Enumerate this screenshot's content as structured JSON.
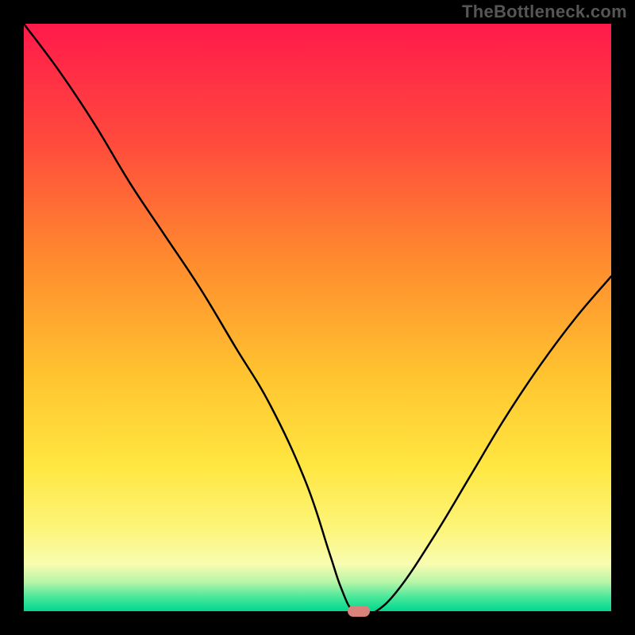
{
  "watermark": "TheBottleneck.com",
  "chart_data": {
    "type": "line",
    "title": "",
    "xlabel": "",
    "ylabel": "",
    "xlim": [
      0,
      100
    ],
    "ylim": [
      0,
      100
    ],
    "grid": false,
    "series": [
      {
        "name": "bottleneck-curve",
        "x": [
          0,
          6,
          12,
          18,
          24,
          30,
          36,
          42,
          48,
          52,
          54,
          56,
          58,
          60,
          64,
          70,
          76,
          82,
          88,
          94,
          100
        ],
        "y": [
          100,
          92,
          83,
          73,
          64,
          55,
          45,
          35,
          22,
          10,
          4,
          0,
          0,
          0,
          4,
          13,
          23,
          33,
          42,
          50,
          57
        ]
      }
    ],
    "marker": {
      "x": 57,
      "y": 0,
      "color": "#d9817b"
    },
    "gradient_stops": [
      {
        "offset": 0.0,
        "color": "#ff1a4b"
      },
      {
        "offset": 0.2,
        "color": "#ff4a3d"
      },
      {
        "offset": 0.4,
        "color": "#ff8a2e"
      },
      {
        "offset": 0.6,
        "color": "#ffc430"
      },
      {
        "offset": 0.75,
        "color": "#ffe640"
      },
      {
        "offset": 0.86,
        "color": "#fdf57a"
      },
      {
        "offset": 0.92,
        "color": "#f8fcb0"
      },
      {
        "offset": 0.95,
        "color": "#b8f5a8"
      },
      {
        "offset": 0.975,
        "color": "#4de89a"
      },
      {
        "offset": 1.0,
        "color": "#00d88f"
      }
    ]
  }
}
